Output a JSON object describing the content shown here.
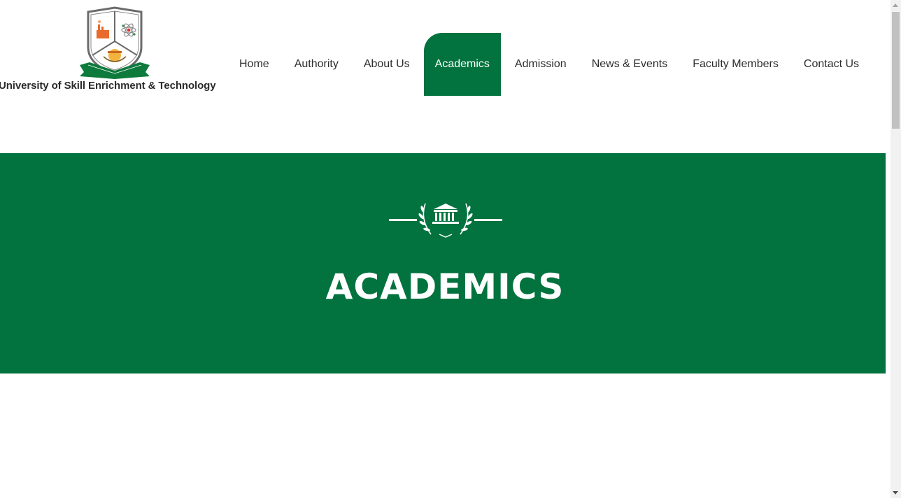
{
  "header": {
    "logo_text": "University of Skill Enrichment & Technology"
  },
  "nav": {
    "items": [
      {
        "label": "Home"
      },
      {
        "label": "Authority"
      },
      {
        "label": "About Us"
      },
      {
        "label": "Academics",
        "active": true
      },
      {
        "label": "Admission"
      },
      {
        "label": "News & Events"
      },
      {
        "label": "Faculty Members"
      },
      {
        "label": "Contact Us"
      }
    ]
  },
  "hero": {
    "title": "ACADEMICS",
    "icon": "institution-laurel-icon"
  },
  "colors": {
    "brand_green": "#02723e",
    "text_dark": "#2d2d2d",
    "white": "#ffffff"
  }
}
